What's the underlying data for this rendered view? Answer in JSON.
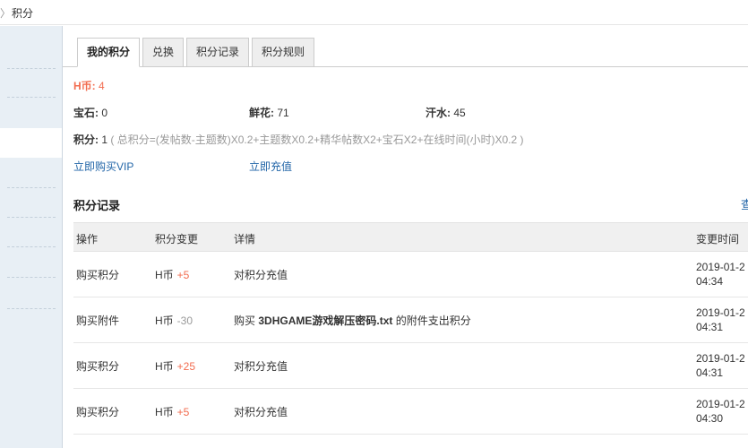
{
  "breadcrumb": {
    "separator": "〉",
    "current": "积分"
  },
  "tabs": [
    {
      "label": "我的积分",
      "active": true
    },
    {
      "label": "兑换",
      "active": false
    },
    {
      "label": "积分记录",
      "active": false
    },
    {
      "label": "积分规则",
      "active": false
    }
  ],
  "summary": {
    "hcoin_label": "H币:",
    "hcoin_value": "4",
    "gem_label": "宝石:",
    "gem_value": "0",
    "flower_label": "鲜花:",
    "flower_value": "71",
    "sweat_label": "汗水:",
    "sweat_value": "45",
    "score_label": "积分:",
    "score_value": "1",
    "score_formula": "( 总积分=(发帖数-主题数)X0.2+主题数X0.2+精华帖数X2+宝石X2+在线时间(小时)X0.2 )",
    "buy_vip_link": "立即购买VIP",
    "recharge_link": "立即充值"
  },
  "records": {
    "title": "积分记录",
    "view_more": "查",
    "columns": [
      "操作",
      "积分变更",
      "详情",
      "变更时间"
    ],
    "rows": [
      {
        "action": "购买积分",
        "currency": "H币",
        "change": "+5",
        "detail_prefix": "对积分充值",
        "detail_file": "",
        "detail_suffix": "",
        "date": "2019-01-2",
        "time": "04:34"
      },
      {
        "action": "购买附件",
        "currency": "H币",
        "change": "-30",
        "detail_prefix": "购买",
        "detail_file": "3DHGAME游戏解压密码.txt",
        "detail_suffix": "的附件支出积分",
        "date": "2019-01-2",
        "time": "04:31"
      },
      {
        "action": "购买积分",
        "currency": "H币",
        "change": "+25",
        "detail_prefix": "对积分充值",
        "detail_file": "",
        "detail_suffix": "",
        "date": "2019-01-2",
        "time": "04:31"
      },
      {
        "action": "购买积分",
        "currency": "H币",
        "change": "+5",
        "detail_prefix": "对积分充值",
        "detail_file": "",
        "detail_suffix": "",
        "date": "2019-01-2",
        "time": "04:30"
      }
    ]
  },
  "colors": {
    "accent_red": "#f26c4f",
    "link_blue": "#2366a8",
    "sidebar_bg": "#e8eff5"
  }
}
